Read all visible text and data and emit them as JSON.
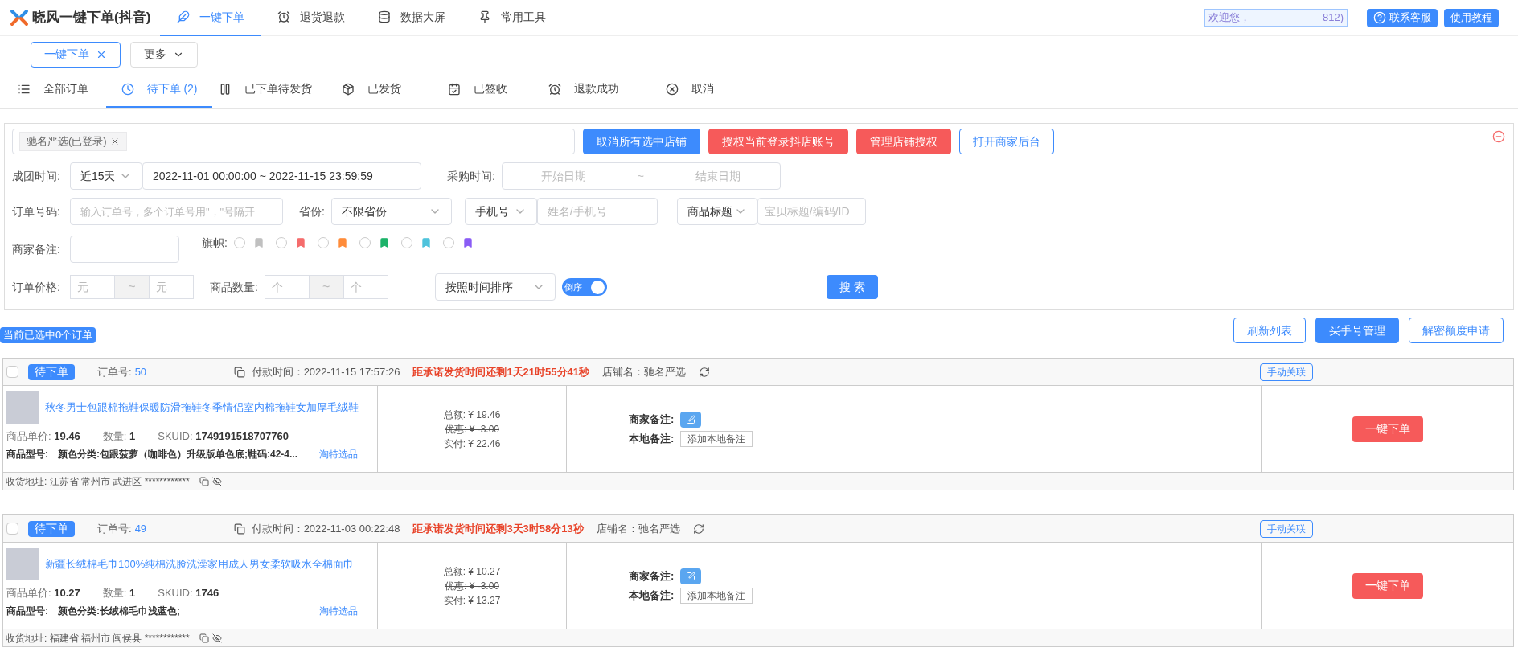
{
  "app": {
    "title": "晓风一键下单(抖音)"
  },
  "nav_tabs": [
    {
      "label": "一键下单",
      "selected": true
    },
    {
      "label": "退货退款",
      "selected": false
    },
    {
      "label": "数据大屏",
      "selected": false
    },
    {
      "label": "常用工具",
      "selected": false
    }
  ],
  "header": {
    "welcome_start": "欢迎您，",
    "welcome_end": "812)",
    "buttons": [
      "联系客服",
      "使用教程"
    ]
  },
  "open_tabs": [
    {
      "label": "一键下单",
      "closable": true,
      "selected": true
    },
    {
      "label": "更多",
      "closable": false,
      "selected": false
    }
  ],
  "status_tabs": [
    {
      "label": "全部订单",
      "selected": false
    },
    {
      "label": "待下单 (2)",
      "selected": true
    },
    {
      "label": "已下单待发货",
      "selected": false
    },
    {
      "label": "已发货",
      "selected": false
    },
    {
      "label": "已签收",
      "selected": false
    },
    {
      "label": "退款成功",
      "selected": false
    },
    {
      "label": "取消",
      "selected": false
    }
  ],
  "filters": {
    "shop_tags": [
      "驰名严选(已登录)"
    ],
    "shop_buttons": [
      "取消所有选中店铺",
      "授权当前登录抖店账号",
      "管理店铺授权",
      "打开商家后台"
    ],
    "group_time": {
      "label": "成团时间:",
      "preset": "近15天",
      "range": "2022-11-01 00:00:00 ~ 2022-11-15 23:59:59"
    },
    "purchase_time": {
      "label": "采购时间:",
      "start_placeholder": "开始日期",
      "separator": "~",
      "end_placeholder": "结束日期"
    },
    "order_no": {
      "label": "订单号码:",
      "placeholder": "输入订单号，多个订单号用\"，\"号隔开"
    },
    "province": {
      "label": "省份:",
      "value": "不限省份"
    },
    "contact": {
      "type": "手机号",
      "placeholder": "姓名/手机号"
    },
    "product": {
      "type": "商品标题",
      "placeholder": "宝贝标题/编码/ID"
    },
    "merchant_note": {
      "label": "商家备注:"
    },
    "flags": {
      "label": "旗帜:",
      "items": [
        {
          "color": "#c0c0c0",
          "selected": false
        },
        {
          "color": "#f56c6c",
          "selected": false
        },
        {
          "color": "#ff8c3a",
          "selected": false
        },
        {
          "color": "#1db36a",
          "selected": false
        },
        {
          "color": "#4fc3dc",
          "selected": false
        },
        {
          "color": "#8a5cf5",
          "selected": false
        }
      ]
    },
    "price": {
      "label": "订单价格:",
      "min_placeholder": "元",
      "separator": "~",
      "max_placeholder": "元"
    },
    "quantity": {
      "label": "商品数量:",
      "min_placeholder": "个",
      "separator": "~",
      "max_placeholder": "个"
    },
    "sort": {
      "value": "按照时间排序",
      "toggle_label": "倒序",
      "on": true
    },
    "search_button": "搜 索"
  },
  "selection_badge": "当前已选中0个订单",
  "list_buttons": [
    "刷新列表",
    "买手号管理",
    "解密额度申请"
  ],
  "orders": [
    {
      "checked": false,
      "status": "待下单",
      "order_no_label": "订单号:",
      "order_no": "50",
      "pay_time": "付款时间：2022-11-15 17:57:26",
      "deadline": "距承诺发货时间还剩1天21时55分41秒",
      "shop": "店铺名：驰名严选",
      "link_button": "手动关联",
      "title": "秋冬男士包跟棉拖鞋保暖防滑拖鞋冬季情侣室内棉拖鞋女加厚毛绒鞋",
      "price_label": "商品单价:",
      "price": "19.46",
      "qty_label": "数量:",
      "qty": "1",
      "sku_label": "SKUID:",
      "sku": "1749191518707760",
      "model_label": "商品型号:",
      "model": "颜色分类:包跟菠萝（咖啡色）升级版单色底;鞋码:42-4...",
      "pick": "淘特选品",
      "total": "总额: ¥ 19.46",
      "discount": "优惠: ¥ -3.00",
      "paid": "实付: ¥ 22.46",
      "merchant_note_label": "商家备注:",
      "local_note_label": "本地备注:",
      "local_note_button": "添加本地备注",
      "order_button": "一键下单",
      "address": "收货地址: 江苏省 常州市 武进区 ************"
    },
    {
      "checked": false,
      "status": "待下单",
      "order_no_label": "订单号:",
      "order_no": "49",
      "pay_time": "付款时间：2022-11-03 00:22:48",
      "deadline": "距承诺发货时间还剩3天3时58分13秒",
      "shop": "店铺名：驰名严选",
      "link_button": "手动关联",
      "title": "新疆长绒棉毛巾100%纯棉洗脸洗澡家用成人男女柔软吸水全棉面巾",
      "price_label": "商品单价:",
      "price": "10.27",
      "qty_label": "数量:",
      "qty": "1",
      "sku_label": "SKUID:",
      "sku": "1746",
      "model_label": "商品型号:",
      "model": "颜色分类:长绒棉毛巾浅蓝色;",
      "pick": "淘特选品",
      "total": "总额: ¥ 10.27",
      "discount": "优惠: ¥ -3.00",
      "paid": "实付: ¥ 13.27",
      "merchant_note_label": "商家备注:",
      "local_note_label": "本地备注:",
      "local_note_button": "添加本地备注",
      "order_button": "一键下单",
      "address": "收货地址: 福建省 福州市 闽侯县 ************"
    }
  ]
}
